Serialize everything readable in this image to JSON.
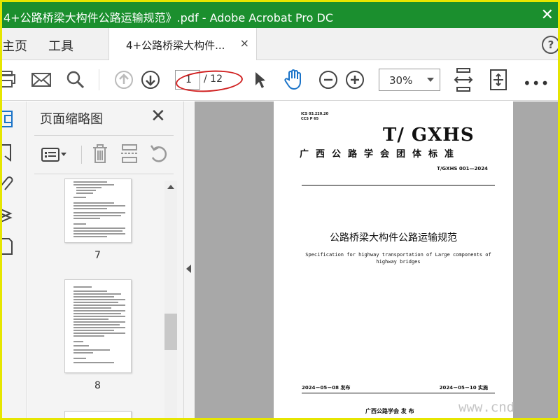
{
  "window": {
    "title": "4+公路桥梁大构件公路运输规范》.pdf - Adobe Acrobat Pro DC",
    "title_prefix": "|"
  },
  "menu": {
    "home": "主页",
    "tools": "工具"
  },
  "doc_tab": {
    "label": "4+公路桥梁大构件...",
    "close": "×"
  },
  "help": "?",
  "toolbar": {
    "page_current": "1",
    "page_total": "/ 12",
    "zoom": "30%",
    "more": "•••"
  },
  "thumbnails": {
    "title": "页面缩略图",
    "pages": [
      {
        "number": "7"
      },
      {
        "number": "8"
      }
    ]
  },
  "document": {
    "ics": "ICS 03.220.20",
    "ccs": "CCS P 65",
    "standard_code": "T/ GXHS",
    "association_title": "广西公路学会团体标准",
    "standard_number": "T/GXHS 001—2024",
    "title_cn": "公路桥梁大构件公路运输规范",
    "title_en": "Specification for highway transportation of Large components of highway bridges",
    "publish_date": "2024－05－08 发布",
    "implement_date": "2024－05－10 实施",
    "issuer": "广西公路学会     发  布"
  },
  "watermark": "www.cnd",
  "colors": {
    "titlebar": "#1b8f2e",
    "accent_blue": "#1a73c8",
    "highlight_red": "#d02020"
  }
}
